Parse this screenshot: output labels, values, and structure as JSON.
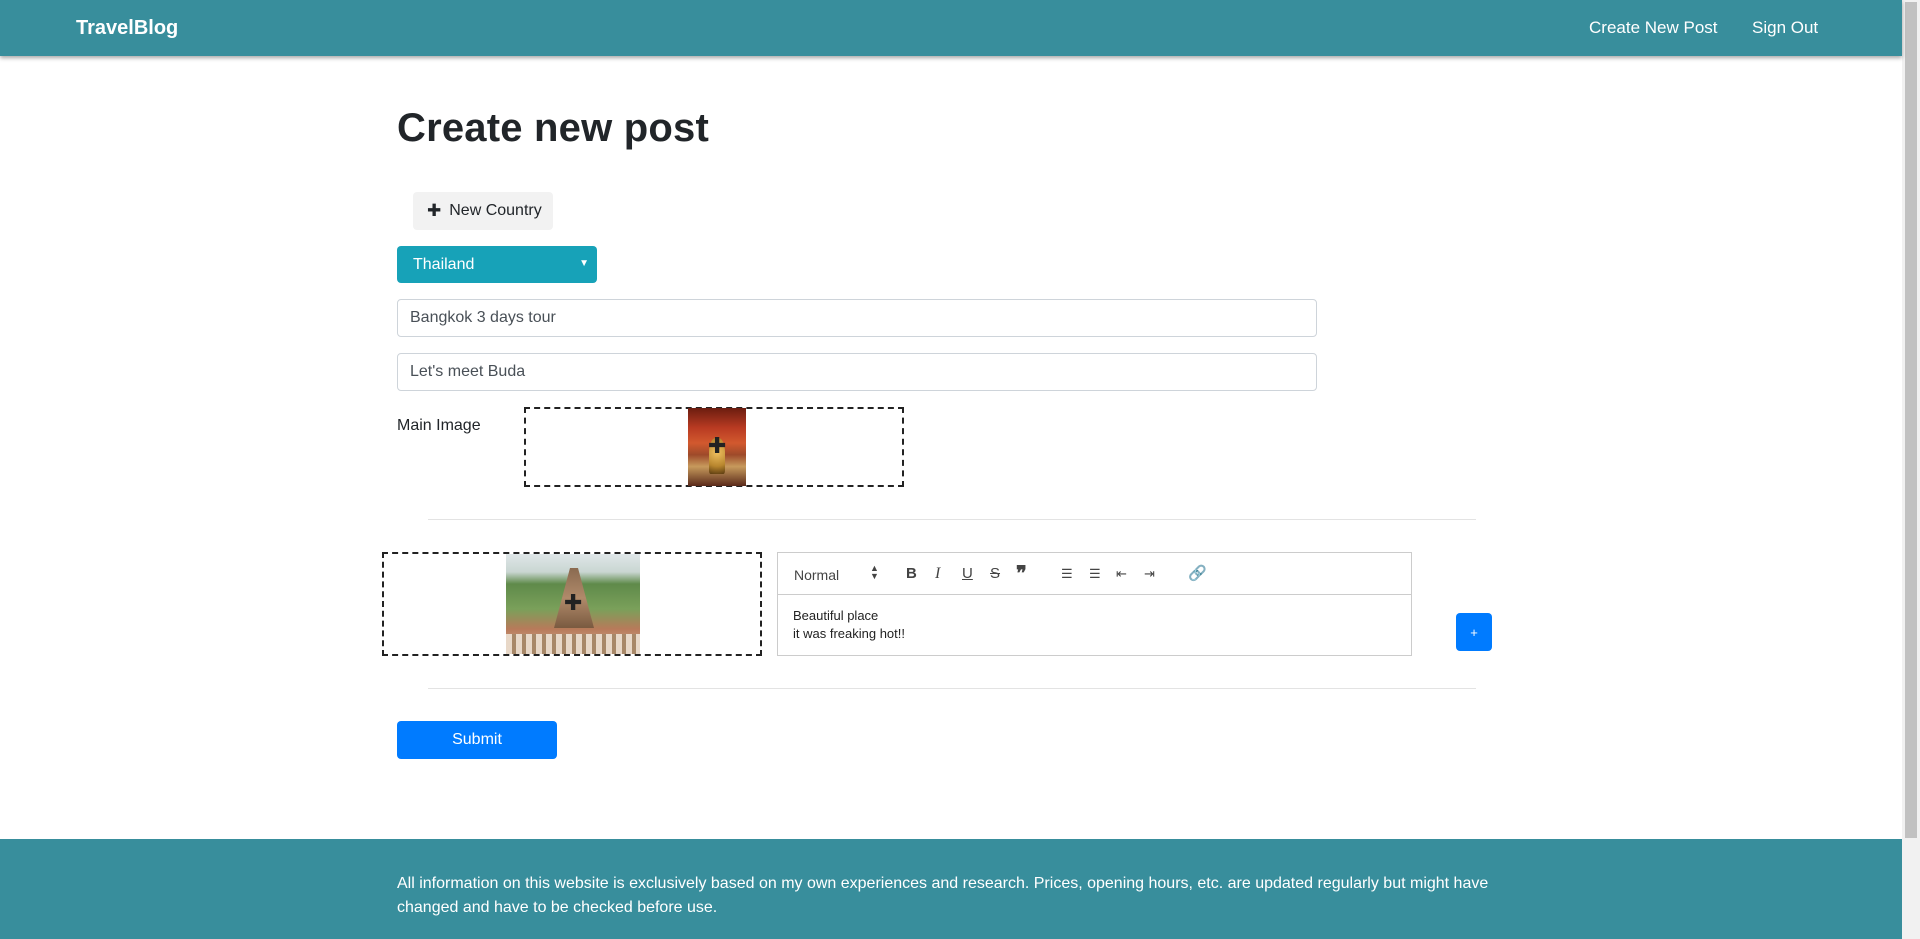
{
  "navbar": {
    "brand": "TravelBlog",
    "create_new_post": "Create New Post",
    "sign_out": "Sign Out"
  },
  "page": {
    "title": "Create new post"
  },
  "form": {
    "new_country_label": "New Country",
    "country_selected": "Thailand",
    "title_value": "Bangkok 3 days tour",
    "subtitle_value": "Let's meet Buda",
    "main_image_label": "Main Image",
    "submit_label": "Submit"
  },
  "section": {
    "editor": {
      "header_format": "Normal",
      "toolbar": {
        "bold": "B",
        "italic": "I",
        "underline": "U",
        "strike": "S",
        "quote": "❞",
        "ordered_list": "☰",
        "bullet_list": "☰",
        "outdent": "⇤",
        "indent": "⇥",
        "link": "🔗"
      },
      "lines": [
        "Beautiful place",
        "it was freaking hot!!"
      ]
    },
    "add_button_label": "+"
  },
  "footer": {
    "text": "All information on this website is exclusively based on my own experiences and research. Prices, opening hours, etc. are updated regularly but might have changed and have to be checked before use."
  },
  "colors": {
    "navbar": "#388e9c",
    "select": "#17a2b8",
    "primary": "#007bff"
  },
  "icons": {
    "plus": "plus-icon",
    "move": "move-icon",
    "caret": "caret-down-icon"
  }
}
